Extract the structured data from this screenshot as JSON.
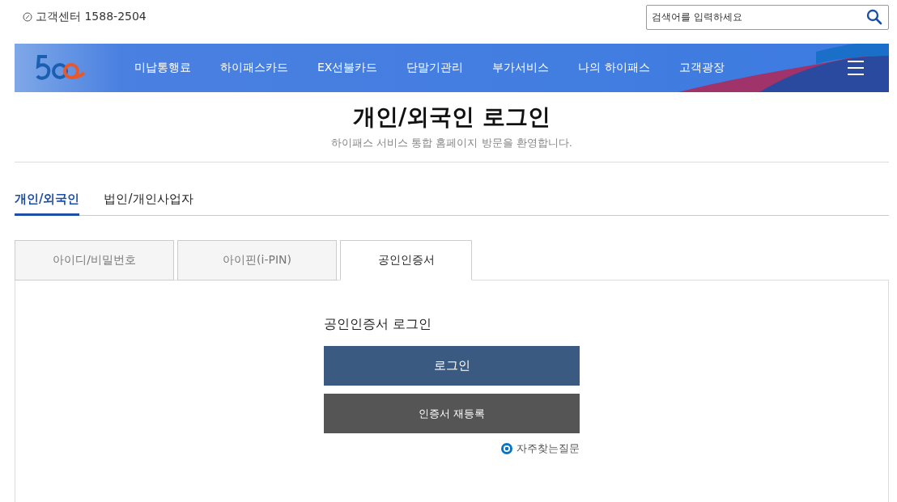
{
  "topbar": {
    "phone": "고객센터 1588-2504",
    "search": {
      "placeholder": "검색어를 입력하세요"
    }
  },
  "nav": {
    "items": [
      "미납통행료",
      "하이패스카드",
      "EX선불카드",
      "단말기관리",
      "부가서비스",
      "나의 하이패스",
      "고객광장"
    ]
  },
  "page": {
    "title": "개인/외국인 로그인",
    "subtitle": "하이패스 서비스 통합 홈페이지 방문을 환영합니다."
  },
  "user_tabs": [
    {
      "label": "개인/외국인",
      "selected": true
    },
    {
      "label": "법인/개인사업자",
      "selected": false
    }
  ],
  "method_tabs": [
    {
      "label": "아이디/비밀번호",
      "selected": false
    },
    {
      "label": "아이핀(i-PIN)",
      "selected": false
    },
    {
      "label": "공인인증서",
      "selected": true
    }
  ],
  "panel": {
    "heading": "공인인증서 로그인",
    "buttons": [
      {
        "label": "로그인",
        "kind": "primary"
      },
      {
        "label": "인증서 재등록",
        "kind": "secondary"
      }
    ],
    "faq_link": "자주찾는질문"
  }
}
